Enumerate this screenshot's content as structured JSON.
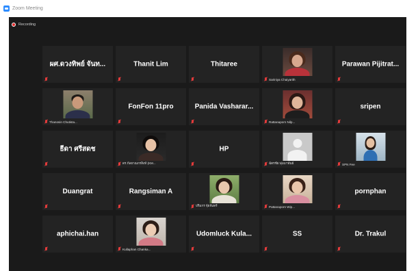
{
  "window": {
    "title": "Zoom Meeting"
  },
  "meeting": {
    "recording_label": "Recording"
  },
  "tiles": [
    {
      "name": "ผศ.ดวงทิพย์ จันท...",
      "label": ""
    },
    {
      "name": "Thanit Lim",
      "label": ""
    },
    {
      "name": "Thitaree",
      "label": ""
    },
    {
      "name": "",
      "label": "Sariniya Chaiyarith"
    },
    {
      "name": "Parawan  Pijitrat...",
      "label": ""
    },
    {
      "name": "",
      "label": "Thanosin Chutista..."
    },
    {
      "name": "FonFon 11pro",
      "label": ""
    },
    {
      "name": "Panida  Vasharar...",
      "label": ""
    },
    {
      "name": "",
      "label": "Rattanaporn Nilp..."
    },
    {
      "name": "sripen",
      "label": ""
    },
    {
      "name": "ธีดา ศรีสดช",
      "label": ""
    },
    {
      "name": "",
      "label": "ดร.กัลยาณกรสิงห์ (KM..."
    },
    {
      "name": "HP",
      "label": ""
    },
    {
      "name": "",
      "label": "ฉัตรชัย พุ่มมาพันธ์"
    },
    {
      "name": "",
      "label": "SPN Fee"
    },
    {
      "name": "Duangrat",
      "label": ""
    },
    {
      "name": "Rangsiman A",
      "label": ""
    },
    {
      "name": "",
      "label": "ปริมกร จุ้ยจันทร์"
    },
    {
      "name": "",
      "label": "Pattanaporn Wip..."
    },
    {
      "name": "pornphan",
      "label": ""
    },
    {
      "name": "aphichai.han",
      "label": ""
    },
    {
      "name": "",
      "label": "Kullaphan Chanka..."
    },
    {
      "name": "Udomluck  Kula...",
      "label": ""
    },
    {
      "name": "SS",
      "label": ""
    },
    {
      "name": "Dr. Trakul",
      "label": ""
    }
  ],
  "colors": {
    "meeting_bg": "#1a1a1a",
    "tile_bg": "#232323",
    "muted_red": "#e23b3b",
    "zoom_blue": "#2d8cff"
  }
}
